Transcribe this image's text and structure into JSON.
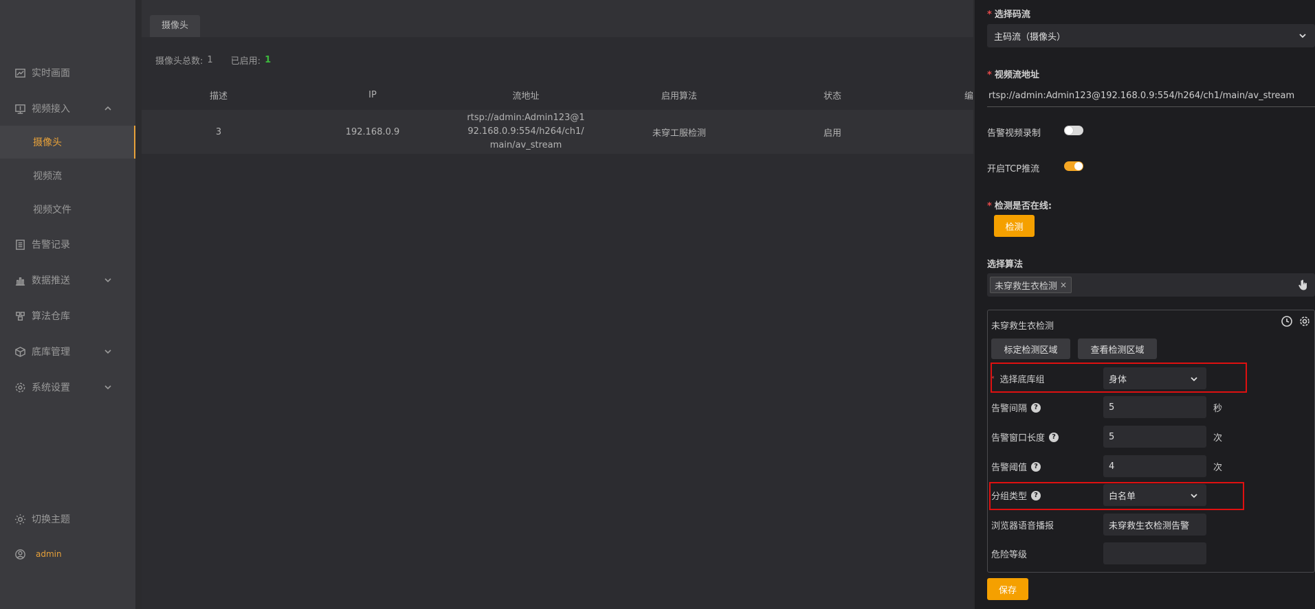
{
  "sidebar": {
    "items": [
      {
        "label": "实时画面",
        "icon": "chart-line-icon"
      },
      {
        "label": "视频接入",
        "icon": "monitor-icon"
      },
      {
        "label": "告警记录",
        "icon": "document-icon"
      },
      {
        "label": "数据推送",
        "icon": "bar-chart-icon"
      },
      {
        "label": "算法仓库",
        "icon": "cubes-icon"
      },
      {
        "label": "底库管理",
        "icon": "box-icon"
      },
      {
        "label": "系统设置",
        "icon": "gear-icon"
      }
    ],
    "sub_items": [
      "摄像头",
      "视频流",
      "视频文件"
    ],
    "theme_label": "切换主题",
    "user": "admin"
  },
  "main": {
    "tab": "摄像头",
    "stats": {
      "total_label": "摄像头总数:",
      "total": "1",
      "enabled_label": "已启用:",
      "enabled": "1"
    },
    "table": {
      "headers": [
        "描述",
        "IP",
        "流地址",
        "启用算法",
        "状态",
        "编"
      ],
      "rows": [
        {
          "desc": "3",
          "ip": "192.168.0.9",
          "url": "rtsp://admin:Admin123@192.168.0.9:554/h264/ch1/main/av_stream",
          "algo": "未穿工服检测",
          "status": "启用"
        }
      ]
    }
  },
  "drawer": {
    "stream_label": "选择码流",
    "stream_value": "主码流（摄像头）",
    "url_label": "视频流地址",
    "url_value": "rtsp://admin:Admin123@192.168.0.9:554/h264/ch1/main/av_stream",
    "record_label": "告警视频录制",
    "record_on": false,
    "tcp_label": "开启TCP推流",
    "tcp_on": true,
    "online_label": "检测是否在线:",
    "detect_button": "检测",
    "algo_label": "选择算法",
    "algo_tag": "未穿救生衣检测",
    "tag_close": "×",
    "algo_box": {
      "title": "未穿救生衣检测",
      "btn_mark": "标定检测区域",
      "btn_view": "查看检测区域",
      "group_label": "选择底库组",
      "group_value": "身体",
      "interval_label": "告警间隔",
      "interval_value": "5",
      "interval_unit": "秒",
      "window_label": "告警窗口长度",
      "window_value": "5",
      "window_unit": "次",
      "threshold_label": "告警阈值",
      "threshold_value": "4",
      "threshold_unit": "次",
      "type_label": "分组类型",
      "type_value": "白名单",
      "voice_label": "浏览器语音播报",
      "voice_value": "未穿救生衣检测告警",
      "danger_label": "危险等级",
      "danger_value": ""
    },
    "save_button": "保存"
  },
  "colors": {
    "accent": "#f5a000",
    "highlight": "#e01010",
    "enabled_green": "#3dbb3d"
  }
}
